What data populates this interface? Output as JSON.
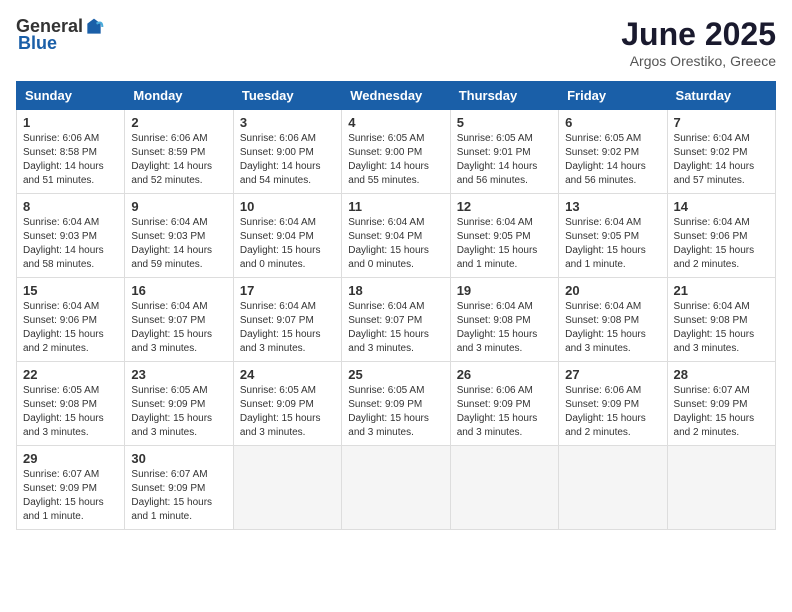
{
  "header": {
    "logo_general": "General",
    "logo_blue": "Blue",
    "title": "June 2025",
    "subtitle": "Argos Orestiko, Greece"
  },
  "days_of_week": [
    "Sunday",
    "Monday",
    "Tuesday",
    "Wednesday",
    "Thursday",
    "Friday",
    "Saturday"
  ],
  "weeks": [
    [
      {
        "day": "1",
        "sunrise": "Sunrise: 6:06 AM",
        "sunset": "Sunset: 8:58 PM",
        "daylight": "Daylight: 14 hours and 51 minutes."
      },
      {
        "day": "2",
        "sunrise": "Sunrise: 6:06 AM",
        "sunset": "Sunset: 8:59 PM",
        "daylight": "Daylight: 14 hours and 52 minutes."
      },
      {
        "day": "3",
        "sunrise": "Sunrise: 6:06 AM",
        "sunset": "Sunset: 9:00 PM",
        "daylight": "Daylight: 14 hours and 54 minutes."
      },
      {
        "day": "4",
        "sunrise": "Sunrise: 6:05 AM",
        "sunset": "Sunset: 9:00 PM",
        "daylight": "Daylight: 14 hours and 55 minutes."
      },
      {
        "day": "5",
        "sunrise": "Sunrise: 6:05 AM",
        "sunset": "Sunset: 9:01 PM",
        "daylight": "Daylight: 14 hours and 56 minutes."
      },
      {
        "day": "6",
        "sunrise": "Sunrise: 6:05 AM",
        "sunset": "Sunset: 9:02 PM",
        "daylight": "Daylight: 14 hours and 56 minutes."
      },
      {
        "day": "7",
        "sunrise": "Sunrise: 6:04 AM",
        "sunset": "Sunset: 9:02 PM",
        "daylight": "Daylight: 14 hours and 57 minutes."
      }
    ],
    [
      {
        "day": "8",
        "sunrise": "Sunrise: 6:04 AM",
        "sunset": "Sunset: 9:03 PM",
        "daylight": "Daylight: 14 hours and 58 minutes."
      },
      {
        "day": "9",
        "sunrise": "Sunrise: 6:04 AM",
        "sunset": "Sunset: 9:03 PM",
        "daylight": "Daylight: 14 hours and 59 minutes."
      },
      {
        "day": "10",
        "sunrise": "Sunrise: 6:04 AM",
        "sunset": "Sunset: 9:04 PM",
        "daylight": "Daylight: 15 hours and 0 minutes."
      },
      {
        "day": "11",
        "sunrise": "Sunrise: 6:04 AM",
        "sunset": "Sunset: 9:04 PM",
        "daylight": "Daylight: 15 hours and 0 minutes."
      },
      {
        "day": "12",
        "sunrise": "Sunrise: 6:04 AM",
        "sunset": "Sunset: 9:05 PM",
        "daylight": "Daylight: 15 hours and 1 minute."
      },
      {
        "day": "13",
        "sunrise": "Sunrise: 6:04 AM",
        "sunset": "Sunset: 9:05 PM",
        "daylight": "Daylight: 15 hours and 1 minute."
      },
      {
        "day": "14",
        "sunrise": "Sunrise: 6:04 AM",
        "sunset": "Sunset: 9:06 PM",
        "daylight": "Daylight: 15 hours and 2 minutes."
      }
    ],
    [
      {
        "day": "15",
        "sunrise": "Sunrise: 6:04 AM",
        "sunset": "Sunset: 9:06 PM",
        "daylight": "Daylight: 15 hours and 2 minutes."
      },
      {
        "day": "16",
        "sunrise": "Sunrise: 6:04 AM",
        "sunset": "Sunset: 9:07 PM",
        "daylight": "Daylight: 15 hours and 3 minutes."
      },
      {
        "day": "17",
        "sunrise": "Sunrise: 6:04 AM",
        "sunset": "Sunset: 9:07 PM",
        "daylight": "Daylight: 15 hours and 3 minutes."
      },
      {
        "day": "18",
        "sunrise": "Sunrise: 6:04 AM",
        "sunset": "Sunset: 9:07 PM",
        "daylight": "Daylight: 15 hours and 3 minutes."
      },
      {
        "day": "19",
        "sunrise": "Sunrise: 6:04 AM",
        "sunset": "Sunset: 9:08 PM",
        "daylight": "Daylight: 15 hours and 3 minutes."
      },
      {
        "day": "20",
        "sunrise": "Sunrise: 6:04 AM",
        "sunset": "Sunset: 9:08 PM",
        "daylight": "Daylight: 15 hours and 3 minutes."
      },
      {
        "day": "21",
        "sunrise": "Sunrise: 6:04 AM",
        "sunset": "Sunset: 9:08 PM",
        "daylight": "Daylight: 15 hours and 3 minutes."
      }
    ],
    [
      {
        "day": "22",
        "sunrise": "Sunrise: 6:05 AM",
        "sunset": "Sunset: 9:08 PM",
        "daylight": "Daylight: 15 hours and 3 minutes."
      },
      {
        "day": "23",
        "sunrise": "Sunrise: 6:05 AM",
        "sunset": "Sunset: 9:09 PM",
        "daylight": "Daylight: 15 hours and 3 minutes."
      },
      {
        "day": "24",
        "sunrise": "Sunrise: 6:05 AM",
        "sunset": "Sunset: 9:09 PM",
        "daylight": "Daylight: 15 hours and 3 minutes."
      },
      {
        "day": "25",
        "sunrise": "Sunrise: 6:05 AM",
        "sunset": "Sunset: 9:09 PM",
        "daylight": "Daylight: 15 hours and 3 minutes."
      },
      {
        "day": "26",
        "sunrise": "Sunrise: 6:06 AM",
        "sunset": "Sunset: 9:09 PM",
        "daylight": "Daylight: 15 hours and 3 minutes."
      },
      {
        "day": "27",
        "sunrise": "Sunrise: 6:06 AM",
        "sunset": "Sunset: 9:09 PM",
        "daylight": "Daylight: 15 hours and 2 minutes."
      },
      {
        "day": "28",
        "sunrise": "Sunrise: 6:07 AM",
        "sunset": "Sunset: 9:09 PM",
        "daylight": "Daylight: 15 hours and 2 minutes."
      }
    ],
    [
      {
        "day": "29",
        "sunrise": "Sunrise: 6:07 AM",
        "sunset": "Sunset: 9:09 PM",
        "daylight": "Daylight: 15 hours and 1 minute."
      },
      {
        "day": "30",
        "sunrise": "Sunrise: 6:07 AM",
        "sunset": "Sunset: 9:09 PM",
        "daylight": "Daylight: 15 hours and 1 minute."
      },
      null,
      null,
      null,
      null,
      null
    ]
  ]
}
